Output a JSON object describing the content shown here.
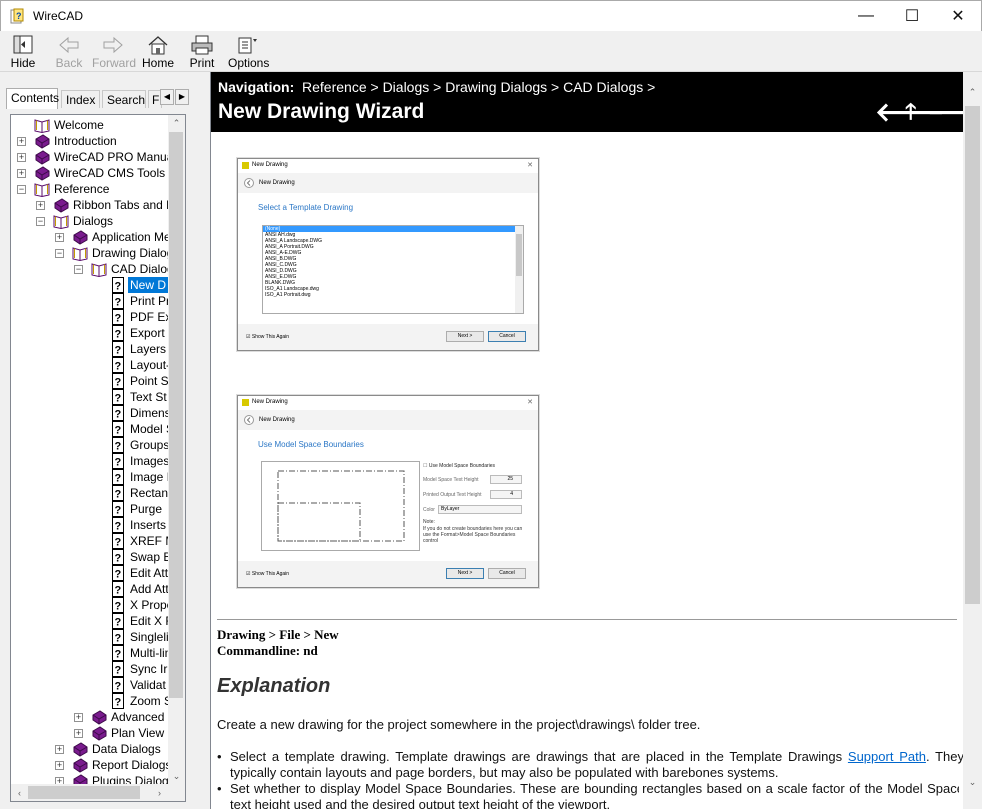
{
  "window": {
    "title": "WireCAD",
    "minimize": "—",
    "maximize": "☐",
    "close": "✕"
  },
  "toolbar": {
    "hide": "Hide",
    "back": "Back",
    "forward": "Forward",
    "home": "Home",
    "print": "Print",
    "options": "Options"
  },
  "tabs": {
    "contents": "Contents",
    "index": "Index",
    "search": "Search",
    "fav": "F"
  },
  "tree": [
    {
      "label": "Welcome",
      "icon": "book-open-icon",
      "level": 0,
      "exp": ""
    },
    {
      "label": "Introduction",
      "icon": "book-closed-icon",
      "level": 0,
      "exp": "+"
    },
    {
      "label": "WireCAD PRO Manual",
      "icon": "book-closed-icon",
      "level": 0,
      "exp": "+"
    },
    {
      "label": "WireCAD CMS Tools M",
      "icon": "book-closed-icon",
      "level": 0,
      "exp": "+"
    },
    {
      "label": "Reference",
      "icon": "book-open-icon",
      "level": 0,
      "exp": "-"
    },
    {
      "label": "Ribbon Tabs and D",
      "icon": "book-closed-icon",
      "level": 1,
      "exp": "+"
    },
    {
      "label": "Dialogs",
      "icon": "book-open-icon",
      "level": 1,
      "exp": "-"
    },
    {
      "label": "Application Men",
      "icon": "book-closed-icon",
      "level": 2,
      "exp": "+"
    },
    {
      "label": "Drawing Dialog",
      "icon": "book-open-icon",
      "level": 2,
      "exp": "-"
    },
    {
      "label": "CAD Dialog",
      "icon": "book-open-icon",
      "level": 3,
      "exp": "-"
    },
    {
      "label": "New D",
      "icon": "help-page-icon",
      "level": 4,
      "exp": "",
      "selected": true
    },
    {
      "label": "Print Pr",
      "icon": "help-page-icon",
      "level": 4,
      "exp": ""
    },
    {
      "label": "PDF Ex",
      "icon": "help-page-icon",
      "level": 4,
      "exp": ""
    },
    {
      "label": "Export",
      "icon": "help-page-icon",
      "level": 4,
      "exp": ""
    },
    {
      "label": "Layers",
      "icon": "help-page-icon",
      "level": 4,
      "exp": ""
    },
    {
      "label": "Layout-",
      "icon": "help-page-icon",
      "level": 4,
      "exp": ""
    },
    {
      "label": "Point S",
      "icon": "help-page-icon",
      "level": 4,
      "exp": ""
    },
    {
      "label": "Text St",
      "icon": "help-page-icon",
      "level": 4,
      "exp": ""
    },
    {
      "label": "Dimens",
      "icon": "help-page-icon",
      "level": 4,
      "exp": ""
    },
    {
      "label": "Model S",
      "icon": "help-page-icon",
      "level": 4,
      "exp": ""
    },
    {
      "label": "Groups",
      "icon": "help-page-icon",
      "level": 4,
      "exp": ""
    },
    {
      "label": "Images",
      "icon": "help-page-icon",
      "level": 4,
      "exp": ""
    },
    {
      "label": "Image I",
      "icon": "help-page-icon",
      "level": 4,
      "exp": ""
    },
    {
      "label": "Rectan",
      "icon": "help-page-icon",
      "level": 4,
      "exp": ""
    },
    {
      "label": "Purge",
      "icon": "help-page-icon",
      "level": 4,
      "exp": ""
    },
    {
      "label": "Inserts",
      "icon": "help-page-icon",
      "level": 4,
      "exp": ""
    },
    {
      "label": "XREF M",
      "icon": "help-page-icon",
      "level": 4,
      "exp": ""
    },
    {
      "label": "Swap B",
      "icon": "help-page-icon",
      "level": 4,
      "exp": ""
    },
    {
      "label": "Edit Att",
      "icon": "help-page-icon",
      "level": 4,
      "exp": ""
    },
    {
      "label": "Add Att",
      "icon": "help-page-icon",
      "level": 4,
      "exp": ""
    },
    {
      "label": "X Prope",
      "icon": "help-page-icon",
      "level": 4,
      "exp": ""
    },
    {
      "label": "Edit X F",
      "icon": "help-page-icon",
      "level": 4,
      "exp": ""
    },
    {
      "label": "Singleli",
      "icon": "help-page-icon",
      "level": 4,
      "exp": ""
    },
    {
      "label": "Multi-lin",
      "icon": "help-page-icon",
      "level": 4,
      "exp": ""
    },
    {
      "label": "Sync Ir",
      "icon": "help-page-icon",
      "level": 4,
      "exp": ""
    },
    {
      "label": "Validat",
      "icon": "help-page-icon",
      "level": 4,
      "exp": ""
    },
    {
      "label": "Zoom S",
      "icon": "help-page-icon",
      "level": 4,
      "exp": ""
    },
    {
      "label": "Advanced",
      "icon": "book-closed-icon",
      "level": 3,
      "exp": "+"
    },
    {
      "label": "Plan View a",
      "icon": "book-closed-icon",
      "level": 3,
      "exp": "+"
    },
    {
      "label": "Data Dialogs",
      "icon": "book-closed-icon",
      "level": 2,
      "exp": "+"
    },
    {
      "label": "Report Dialogs",
      "icon": "book-closed-icon",
      "level": 2,
      "exp": "+"
    },
    {
      "label": "Plugins Dialogs",
      "icon": "book-closed-icon",
      "level": 2,
      "exp": "+"
    }
  ],
  "nav": {
    "label": "Navigation:",
    "path": "Reference > Dialogs > Drawing Dialogs > CAD Dialogs >",
    "title": "New Drawing Wizard",
    "prev": "🡐",
    "up": "🡑",
    "next": "🡒"
  },
  "shot1": {
    "title": "New Drawing",
    "close": "✕",
    "subtitle": "New Drawing",
    "heading": "Select a Template Drawing",
    "items": [
      "(None)",
      "ANSI AH.dwg",
      "ANSI_A Landscape.DWG",
      "ANSI_A Portrait.DWG",
      "ANSI_A-E.DWG",
      "ANSI_B.DWG",
      "ANSI_C.DWG",
      "ANSI_D.DWG",
      "ANSI_E.DWG",
      "BLANK.DWG",
      "ISO_A1 Landscape.dwg",
      "ISO_A1 Portrait.dwg"
    ],
    "show_again": "Show This Again",
    "next": "Next >",
    "cancel": "Cancel"
  },
  "shot2": {
    "title": "New Drawing",
    "close": "✕",
    "subtitle": "New Drawing",
    "heading": "Use Model Space Boundaries",
    "use_bounds": "Use Model Space Boundaries",
    "ms_text_label": "Model Space Text Height",
    "ms_text_value": "25",
    "po_text_label": "Printed Output Text Height",
    "po_text_value": "4",
    "color_label": "Color",
    "color_value": "ByLayer",
    "note": "Note:",
    "note_text": "If you do not create boundaries here you can use the Format>Model Space Boundaries control",
    "show_again": "Show This Again",
    "next": "Next >",
    "cancel": "Cancel"
  },
  "body": {
    "cmd1": "Drawing > File > New",
    "cmd2": "Commandline: nd",
    "explanation": "Explanation",
    "intro": "Create a new drawing for the project somewhere in the project\\drawings\\ folder tree.",
    "bullet1_pre": "Select a template drawing. Template drawings are drawings that are placed in the Template Drawings ",
    "bullet1_link": "Support Path",
    "bullet1_post": ". They typically contain layouts and page borders, but may also be populated with barebones systems.",
    "bullet2": "Set whether to display Model Space Boundaries. These are bounding rectangles based on a scale factor of the Model Space text height used and the desired output text height of the viewport."
  }
}
